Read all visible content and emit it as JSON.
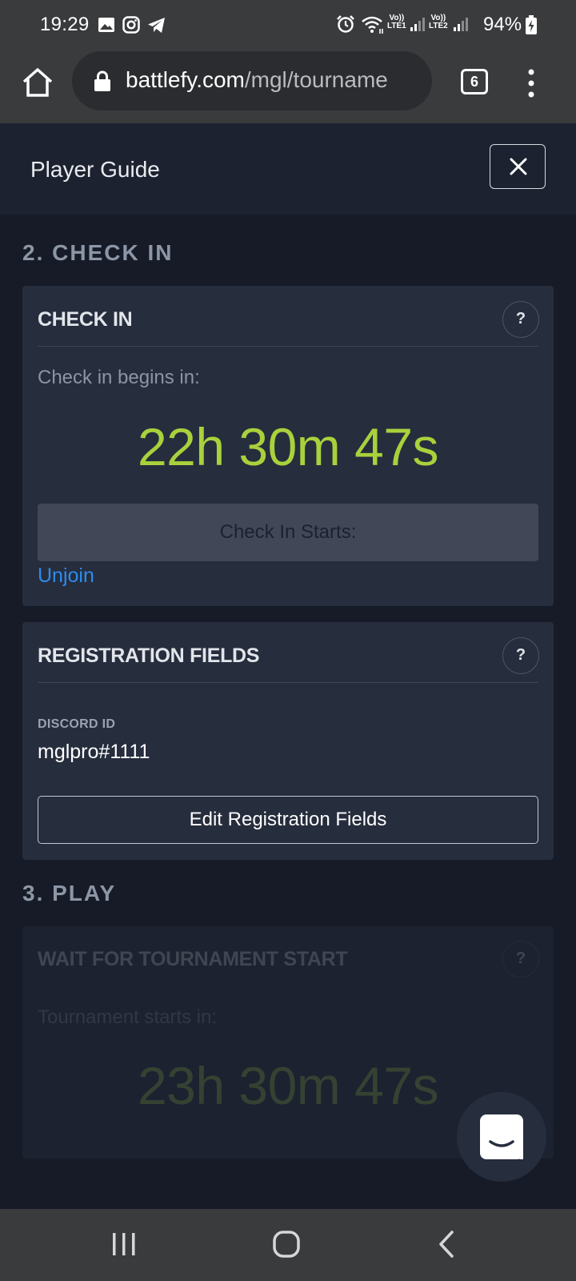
{
  "status_bar": {
    "time": "19:29",
    "battery": "94%",
    "sim1_label_top": "Vo))",
    "sim1_label_bottom": "LTE1",
    "sim2_label_top": "Vo))",
    "sim2_label_bottom": "LTE2"
  },
  "browser": {
    "url_host": "battlefy.com",
    "url_path": "/mgl/tourname",
    "tab_count": "6"
  },
  "header": {
    "title": "Player Guide"
  },
  "sections": {
    "check_in_title": "2. CHECK IN",
    "play_title": "3. PLAY"
  },
  "check_in_card": {
    "title": "CHECK IN",
    "help": "?",
    "begins_label": "Check in begins in:",
    "countdown": "22h 30m 47s",
    "button_label": "Check In Starts:",
    "unjoin_label": "Unjoin"
  },
  "registration_card": {
    "title": "REGISTRATION FIELDS",
    "help": "?",
    "field_label": "DISCORD ID",
    "field_value": "mglpro#1111",
    "edit_button": "Edit Registration Fields"
  },
  "play_card": {
    "title": "WAIT FOR TOURNAMENT START",
    "help": "?",
    "starts_label": "Tournament starts in:",
    "countdown": "23h 30m 47s"
  },
  "colors": {
    "accent_green": "#a8d13c",
    "link_blue": "#2d8cf0",
    "page_bg": "#161b27",
    "card_bg": "#262d3d"
  }
}
